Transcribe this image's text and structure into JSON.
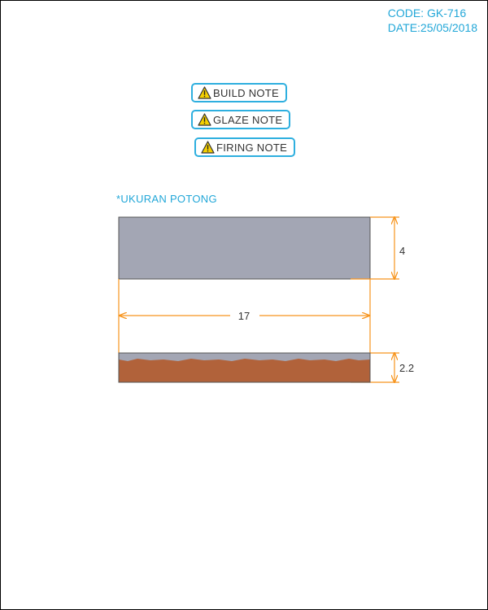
{
  "header": {
    "code": "CODE: GK-716",
    "date": "DATE:25/05/2018"
  },
  "notes": [
    {
      "label": "BUILD NOTE",
      "icon": "warning-icon"
    },
    {
      "label": "GLAZE NOTE",
      "icon": "warning-icon"
    },
    {
      "label": "FIRING NOTE",
      "icon": "warning-icon"
    }
  ],
  "drawing": {
    "caption": "*UKURAN POTONG",
    "top_height": "4",
    "length": "17",
    "side_height": "2.2"
  },
  "colors": {
    "accent": "#22a7d8",
    "dimension": "#f7941d",
    "glaze": "#a3a6b4",
    "clay": "#b1623a",
    "warning": "#f5d000"
  }
}
